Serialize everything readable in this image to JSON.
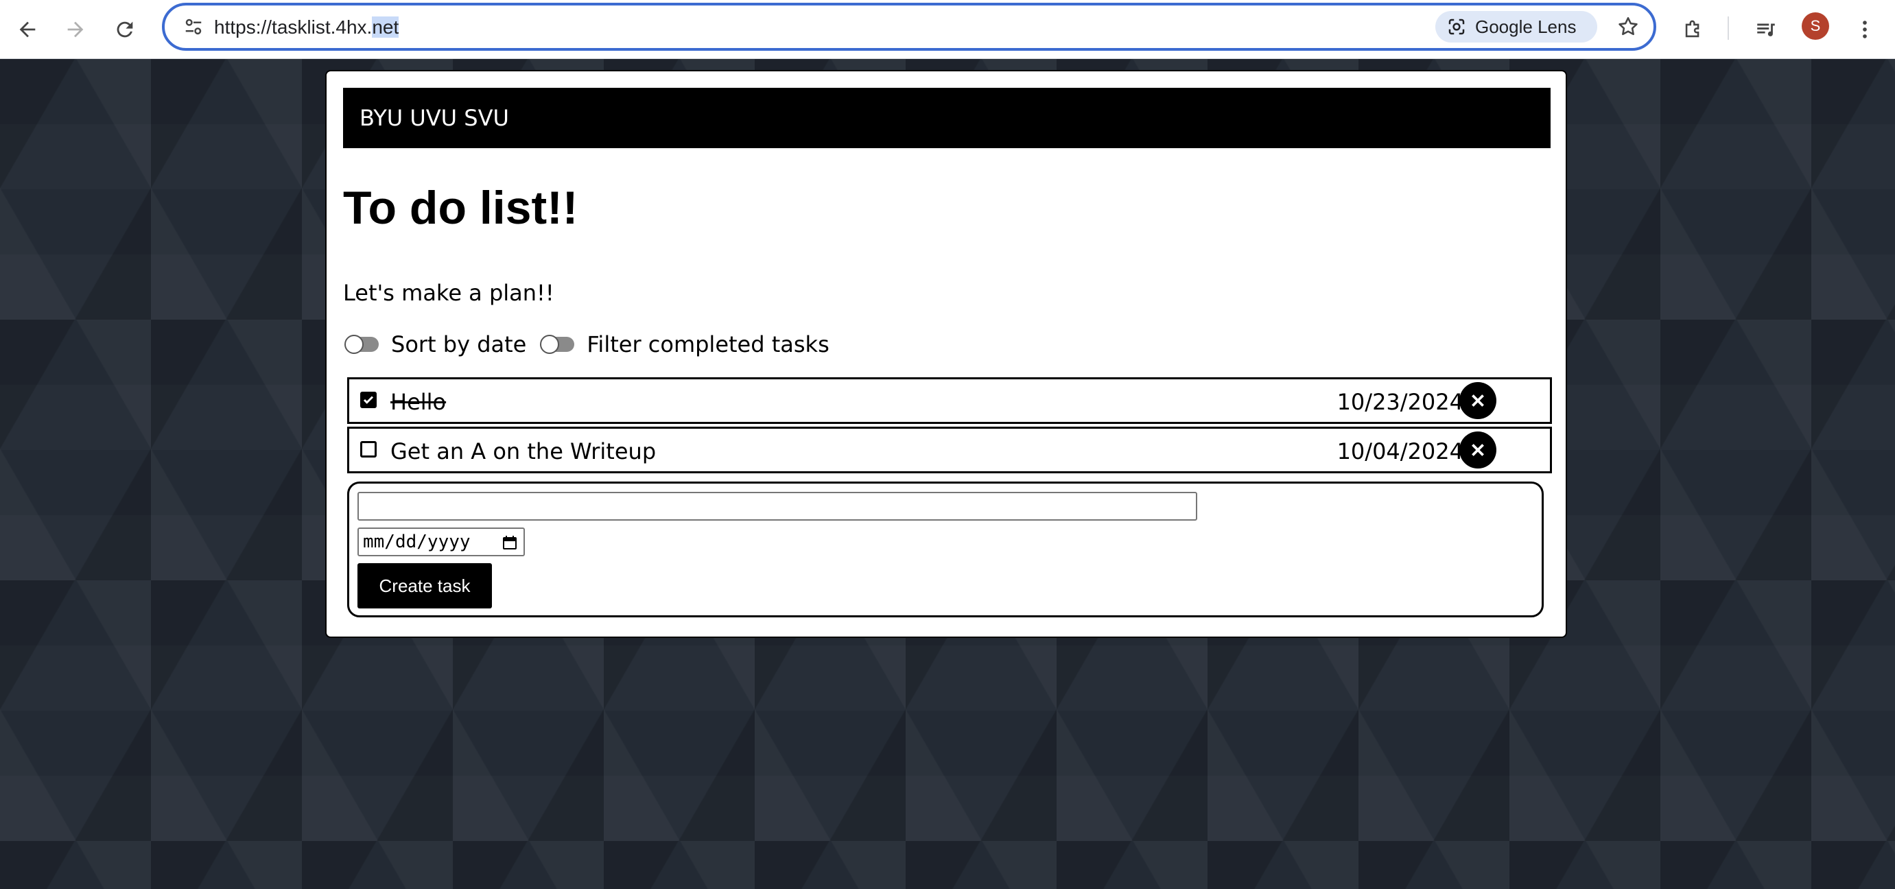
{
  "browser": {
    "url_main": "https://tasklist.4hx.",
    "url_selected": "net",
    "lens_label": "Google Lens",
    "profile_initial": "S",
    "icons": [
      "back-arrow-icon",
      "forward-arrow-icon",
      "reload-icon",
      "site-info-icon",
      "google-lens-icon",
      "bookmark-star-icon",
      "extensions-icon",
      "media-controls-icon",
      "more-menu-icon"
    ]
  },
  "app": {
    "brand": "BYU UVU SVU",
    "title": "To do list!!",
    "subtitle": "Let's make a plan!!",
    "controls": {
      "sort_label": "Sort by date",
      "filter_label": "Filter completed tasks",
      "sort_on": false,
      "filter_on": false
    },
    "tasks": [
      {
        "title": "Hello",
        "date": "10/23/2024",
        "completed": true
      },
      {
        "title": "Get an A on the Writeup",
        "date": "10/04/2024",
        "completed": false
      }
    ],
    "form": {
      "title_value": "",
      "date_placeholder": "mm/dd/yyyy",
      "create_label": "Create task"
    }
  }
}
